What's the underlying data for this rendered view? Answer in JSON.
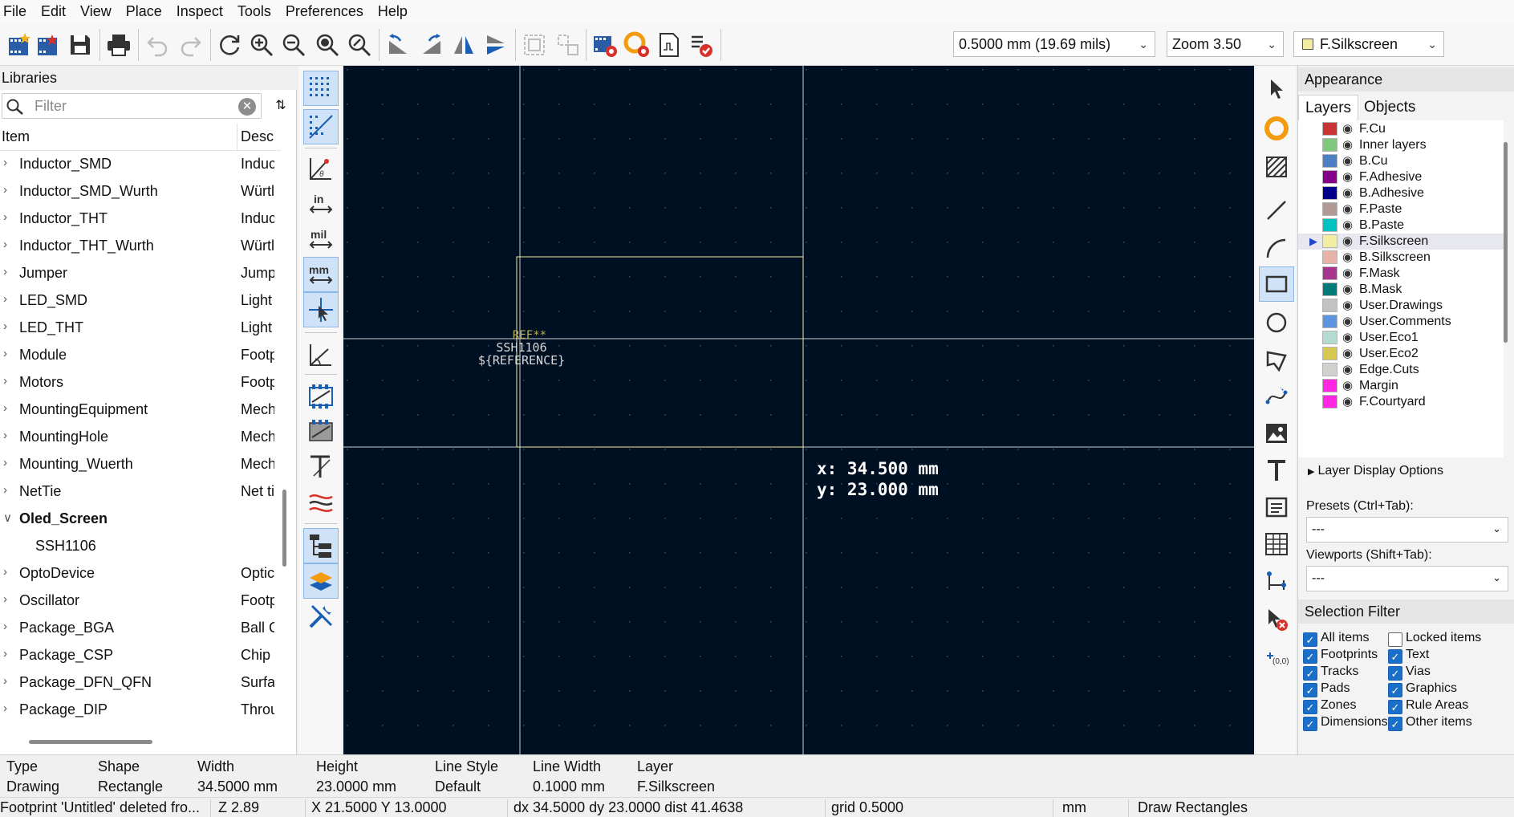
{
  "menu": [
    "File",
    "Edit",
    "View",
    "Place",
    "Inspect",
    "Tools",
    "Preferences",
    "Help"
  ],
  "toolbar": {
    "grid_value": "0.5000 mm (19.69 mils)",
    "zoom_value": "Zoom 3.50",
    "layer_value": "F.Silkscreen",
    "layer_color": "#f2eda1"
  },
  "libraries": {
    "title": "Libraries",
    "filter_placeholder": "Filter",
    "col_item": "Item",
    "col_desc": "Desc",
    "rows": [
      {
        "name": "Inductor_SMD",
        "desc": "Induc",
        "expanded": false
      },
      {
        "name": "Inductor_SMD_Wurth",
        "desc": "Würtl",
        "expanded": false
      },
      {
        "name": "Inductor_THT",
        "desc": "Induc",
        "expanded": false
      },
      {
        "name": "Inductor_THT_Wurth",
        "desc": "Würtl",
        "expanded": false
      },
      {
        "name": "Jumper",
        "desc": "Jump",
        "expanded": false
      },
      {
        "name": "LED_SMD",
        "desc": "Light",
        "expanded": false
      },
      {
        "name": "LED_THT",
        "desc": "Light",
        "expanded": false
      },
      {
        "name": "Module",
        "desc": "Footp",
        "expanded": false
      },
      {
        "name": "Motors",
        "desc": "Footp",
        "expanded": false
      },
      {
        "name": "MountingEquipment",
        "desc": "Mech",
        "expanded": false
      },
      {
        "name": "MountingHole",
        "desc": "Mech",
        "expanded": false
      },
      {
        "name": "Mounting_Wuerth",
        "desc": "Mech",
        "expanded": false
      },
      {
        "name": "NetTie",
        "desc": "Net ti",
        "expanded": false
      },
      {
        "name": "Oled_Screen",
        "desc": "",
        "expanded": true
      },
      {
        "name": "SSH1106",
        "desc": "",
        "child": true
      },
      {
        "name": "OptoDevice",
        "desc": "Optic",
        "expanded": false
      },
      {
        "name": "Oscillator",
        "desc": "Footp",
        "expanded": false
      },
      {
        "name": "Package_BGA",
        "desc": "Ball G",
        "expanded": false
      },
      {
        "name": "Package_CSP",
        "desc": "Chip",
        "expanded": false
      },
      {
        "name": "Package_DFN_QFN",
        "desc": "Surfa",
        "expanded": false
      },
      {
        "name": "Package_DIP",
        "desc": "Throu",
        "expanded": false
      }
    ]
  },
  "canvas": {
    "background": "#001023",
    "ref_text": "REF**",
    "value_text": "SSH1106",
    "ref_field_text": "${REFERENCE}",
    "readout_x": "x: 34.500 mm",
    "readout_y": "y: 23.000 mm"
  },
  "appearance": {
    "title": "Appearance",
    "tab_layers": "Layers",
    "tab_objects": "Objects",
    "layers": [
      {
        "name": "F.Cu",
        "color": "#c83434"
      },
      {
        "name": "Inner layers",
        "color": "#7fc97f"
      },
      {
        "name": "B.Cu",
        "color": "#4d7fc4"
      },
      {
        "name": "F.Adhesive",
        "color": "#84008a"
      },
      {
        "name": "B.Adhesive",
        "color": "#00008a"
      },
      {
        "name": "F.Paste",
        "color": "#b09a93"
      },
      {
        "name": "B.Paste",
        "color": "#00c2c2"
      },
      {
        "name": "F.Silkscreen",
        "color": "#f2eda1",
        "selected": true
      },
      {
        "name": "B.Silkscreen",
        "color": "#e8b2a7"
      },
      {
        "name": "F.Mask",
        "color": "#a7358e"
      },
      {
        "name": "B.Mask",
        "color": "#027a7a"
      },
      {
        "name": "User.Drawings",
        "color": "#c2c2c2"
      },
      {
        "name": "User.Comments",
        "color": "#5e95e0"
      },
      {
        "name": "User.Eco1",
        "color": "#b4dbd2"
      },
      {
        "name": "User.Eco2",
        "color": "#d8c852"
      },
      {
        "name": "Edge.Cuts",
        "color": "#d0d2cd"
      },
      {
        "name": "Margin",
        "color": "#ff26e2"
      },
      {
        "name": "F.Courtyard",
        "color": "#ff26e2"
      }
    ],
    "layer_display_options": "Layer Display Options",
    "presets_label": "Presets (Ctrl+Tab):",
    "presets_value": "---",
    "viewports_label": "Viewports (Shift+Tab):",
    "viewports_value": "---"
  },
  "selection_filter": {
    "title": "Selection Filter",
    "items": [
      {
        "label": "All items",
        "checked": true
      },
      {
        "label": "Locked items",
        "checked": false
      },
      {
        "label": "Footprints",
        "checked": true
      },
      {
        "label": "Text",
        "checked": true
      },
      {
        "label": "Tracks",
        "checked": true
      },
      {
        "label": "Vias",
        "checked": true
      },
      {
        "label": "Pads",
        "checked": true
      },
      {
        "label": "Graphics",
        "checked": true
      },
      {
        "label": "Zones",
        "checked": true
      },
      {
        "label": "Rule Areas",
        "checked": true
      },
      {
        "label": "Dimensions",
        "checked": true
      },
      {
        "label": "Other items",
        "checked": true
      }
    ]
  },
  "message_panel": [
    {
      "header": "Type",
      "value": "Drawing"
    },
    {
      "header": "Shape",
      "value": "Rectangle"
    },
    {
      "header": "Width",
      "value": "34.5000 mm"
    },
    {
      "header": "Height",
      "value": "23.0000 mm"
    },
    {
      "header": "Line Style",
      "value": "Default"
    },
    {
      "header": "Line Width",
      "value": "0.1000 mm"
    },
    {
      "header": "Layer",
      "value": "F.Silkscreen"
    }
  ],
  "statusbar": {
    "message": "Footprint 'Untitled' deleted fro...",
    "zoom": "Z 2.89",
    "xy": "X 21.5000  Y 13.0000",
    "delta": "dx 34.5000  dy 23.0000  dist 41.4638",
    "grid": "grid 0.5000",
    "units": "mm",
    "tool": "Draw Rectangles"
  }
}
